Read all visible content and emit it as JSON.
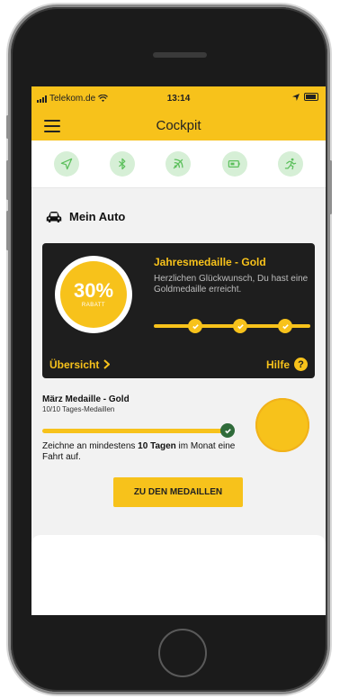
{
  "status": {
    "carrier": "Telekom.de",
    "time": "13:14"
  },
  "header": {
    "title": "Cockpit"
  },
  "iconbar": {
    "icons": [
      "location-icon",
      "bluetooth-icon",
      "signal-off-icon",
      "battery-icon",
      "activity-icon"
    ]
  },
  "my_car": {
    "title": "Mein Auto"
  },
  "year_medal": {
    "percent": "30%",
    "discount_label": "RABATT",
    "title": "Jahresmedaille - Gold",
    "text": "Herzlichen Glückwunsch, Du hast eine Goldmedaille erreicht.",
    "overview_link": "Übersicht",
    "help_label": "Hilfe",
    "help_icon": "?"
  },
  "month_medal": {
    "title": "März Medaille - Gold",
    "subtitle": "10/10 Tages-Medaillen",
    "progress": 1.0,
    "desc_prefix": "Zeichne an mindestens ",
    "desc_bold": "10 Tagen",
    "desc_suffix": " im Monat eine Fahrt auf.",
    "button_label": "ZU DEN MEDAILLEN"
  },
  "colors": {
    "accent": "#f7c21b",
    "dark": "#1e1e1e",
    "success": "#2f6b3a",
    "icon_bg": "#d6efd6",
    "icon_fg": "#5bbf5b"
  }
}
